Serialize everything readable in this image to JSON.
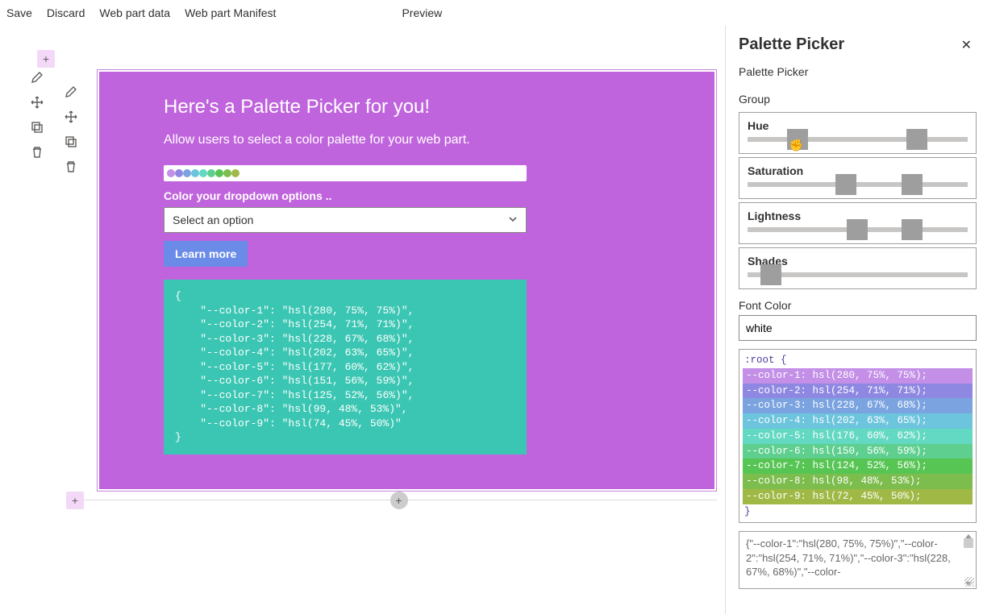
{
  "toolbar": {
    "save": "Save",
    "discard": "Discard",
    "data": "Web part data",
    "manifest": "Web part Manifest",
    "preview": "Preview"
  },
  "webpart": {
    "heading": "Here's a Palette Picker for you!",
    "sub": "Allow users to select a color palette for your web part.",
    "dd_label": "Color your dropdown options ..",
    "dd_placeholder": "Select an option",
    "learn": "Learn more",
    "json_text": "{\n    \"--color-1\": \"hsl(280, 75%, 75%)\",\n    \"--color-2\": \"hsl(254, 71%, 71%)\",\n    \"--color-3\": \"hsl(228, 67%, 68%)\",\n    \"--color-4\": \"hsl(202, 63%, 65%)\",\n    \"--color-5\": \"hsl(177, 60%, 62%)\",\n    \"--color-6\": \"hsl(151, 56%, 59%)\",\n    \"--color-7\": \"hsl(125, 52%, 56%)\",\n    \"--color-8\": \"hsl(99, 48%, 53%)\",\n    \"--color-9\": \"hsl(74, 45%, 50%)\"\n}",
    "swatches": [
      "#c38fe7",
      "#8f88e2",
      "#7aa3e0",
      "#6cc4dd",
      "#63d8c2",
      "#5ecf8f",
      "#57c554",
      "#7cbd4e",
      "#a0b946"
    ]
  },
  "panel": {
    "title": "Palette Picker",
    "subtitle": "Palette Picker",
    "group_label": "Group",
    "sliders": {
      "hue": {
        "label": "Hue",
        "low": 18,
        "high": 72
      },
      "saturation": {
        "label": "Saturation",
        "low": 40,
        "high": 70
      },
      "lightness": {
        "label": "Lightness",
        "low": 45,
        "high": 70
      },
      "shades": {
        "label": "Shades",
        "single": 9
      }
    },
    "font_color_label": "Font Color",
    "font_color_value": "white",
    "root_open": ":root {",
    "root_close": "}",
    "root_rows": [
      {
        "text": "--color-1: hsl(280, 75%, 75%);",
        "bg": "#c38fe7"
      },
      {
        "text": "--color-2: hsl(254, 71%, 71%);",
        "bg": "#8f88e2"
      },
      {
        "text": "--color-3: hsl(228, 67%, 68%);",
        "bg": "#7aa3e0"
      },
      {
        "text": "--color-4: hsl(202, 63%, 65%);",
        "bg": "#6cc4dd"
      },
      {
        "text": "--color-5: hsl(176, 60%, 62%);",
        "bg": "#63d8c2"
      },
      {
        "text": "--color-6: hsl(150, 56%, 59%);",
        "bg": "#5ecf8f"
      },
      {
        "text": "--color-7: hsl(124, 52%, 56%);",
        "bg": "#57c554"
      },
      {
        "text": "--color-8: hsl(98, 48%, 53%);",
        "bg": "#7cbd4e"
      },
      {
        "text": "--color-9: hsl(72, 45%, 50%);",
        "bg": "#a0b946"
      }
    ],
    "textarea": "{\"--color-1\":\"hsl(280, 75%, 75%)\",\"--color-2\":\"hsl(254, 71%, 71%)\",\"--color-3\":\"hsl(228, 67%, 68%)\",\"--color-"
  }
}
